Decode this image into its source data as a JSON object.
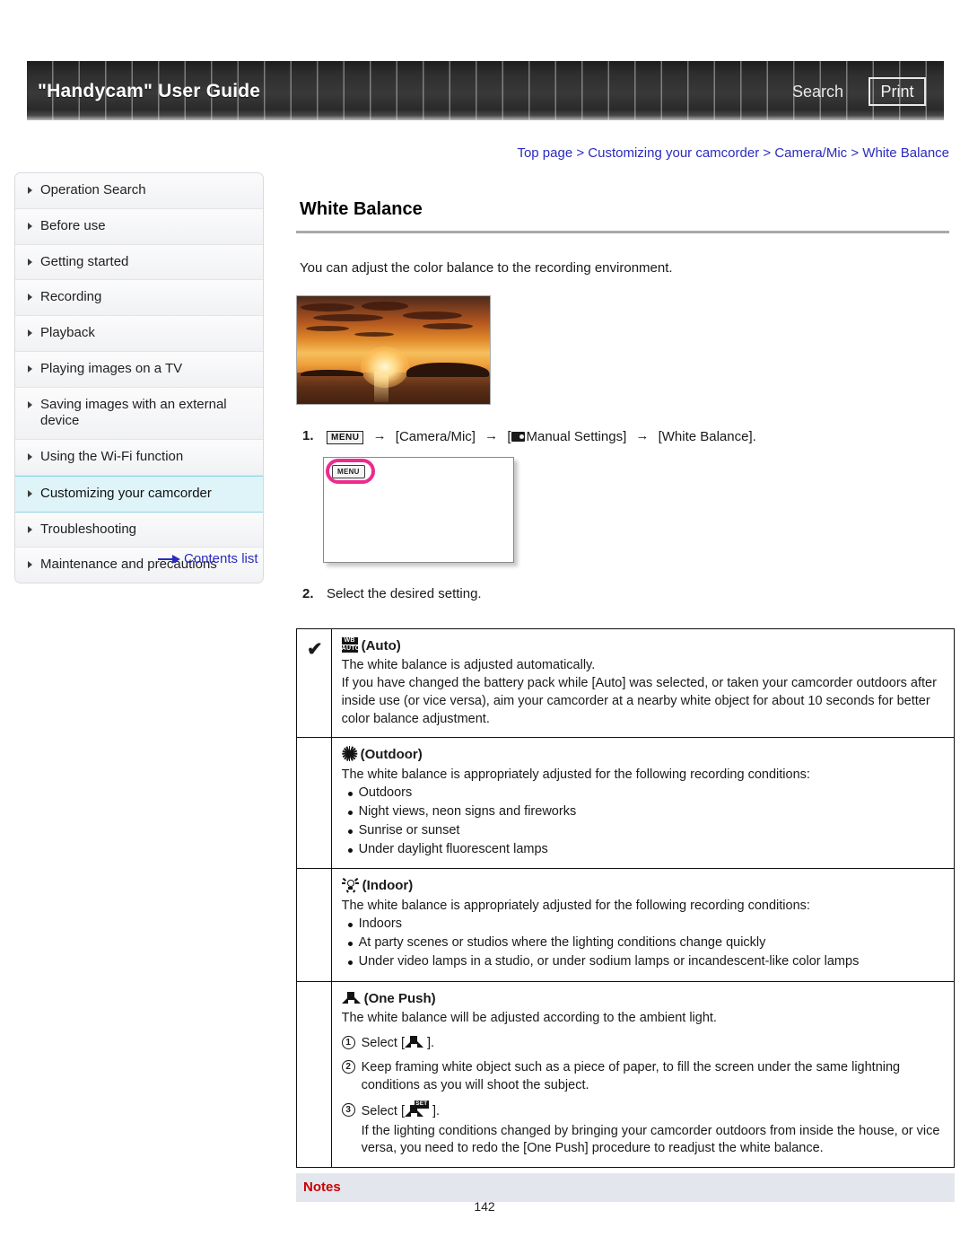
{
  "header": {
    "title": "\"Handycam\" User Guide",
    "search_label": "Search",
    "print_label": "Print"
  },
  "breadcrumb": {
    "items": [
      "Top page",
      "Customizing your camcorder",
      "Camera/Mic",
      "White Balance"
    ],
    "separator": ">"
  },
  "sidebar": {
    "items": [
      {
        "label": "Operation Search",
        "active": false
      },
      {
        "label": "Before use",
        "active": false
      },
      {
        "label": "Getting started",
        "active": false
      },
      {
        "label": "Recording",
        "active": false
      },
      {
        "label": "Playback",
        "active": false
      },
      {
        "label": "Playing images on a TV",
        "active": false
      },
      {
        "label": "Saving images with an external device",
        "active": false
      },
      {
        "label": "Using the Wi-Fi function",
        "active": false
      },
      {
        "label": "Customizing your camcorder",
        "active": true
      },
      {
        "label": "Troubleshooting",
        "active": false
      },
      {
        "label": "Maintenance and precautions",
        "active": false
      }
    ],
    "contents_link": "Contents list"
  },
  "main": {
    "page_title": "White Balance",
    "intro": "You can adjust the color balance to the recording environment.",
    "photo_caption": "sunset over water sample photo",
    "step1": {
      "number": "1.",
      "menu_chip": "MENU",
      "part_camera_mic": "[Camera/Mic]",
      "part_manual_open": "[",
      "part_manual_settings": "Manual Settings]",
      "part_white_balance": "[White Balance].",
      "arrow": "→"
    },
    "lcd_mock": {
      "menu_button_label": "MENU",
      "highlight_color": "#ee2a8e"
    },
    "step2": {
      "number": "2.",
      "text": "Select the desired setting."
    }
  },
  "options_table": {
    "rows": [
      {
        "checked": true,
        "check_glyph": "✔",
        "icon": "wb-auto-icon",
        "heading": "(Auto)",
        "lines": [
          "The white balance is adjusted automatically.",
          "If you have changed the battery pack while [Auto] was selected, or taken your camcorder outdoors after inside use (or vice versa), aim your camcorder at a nearby white object for about 10 seconds for better color balance adjustment."
        ],
        "bullets": [],
        "numbered": []
      },
      {
        "checked": false,
        "check_glyph": "",
        "icon": "outdoor-sun-icon",
        "heading": "(Outdoor)",
        "lines": [
          "The white balance is appropriately adjusted for the following recording conditions:"
        ],
        "bullets": [
          "Outdoors",
          "Night views, neon signs and fireworks",
          "Sunrise or sunset",
          "Under daylight fluorescent lamps"
        ],
        "numbered": []
      },
      {
        "checked": false,
        "check_glyph": "",
        "icon": "indoor-bulb-icon",
        "heading": "(Indoor)",
        "lines": [
          "The white balance is appropriately adjusted for the following recording conditions:"
        ],
        "bullets": [
          "Indoors",
          "At party scenes or studios where the lighting conditions change quickly",
          "Under video lamps in a studio, or under sodium lamps or incandescent-like color lamps"
        ],
        "numbered": []
      },
      {
        "checked": false,
        "check_glyph": "",
        "icon": "one-push-icon",
        "heading": "(One Push)",
        "lines": [
          "The white balance will be adjusted according to the ambient light."
        ],
        "bullets": [],
        "numbered": [
          {
            "n": "1",
            "pre": "Select [",
            "post": "].",
            "sub": ""
          },
          {
            "n": "2",
            "pre": "Keep framing white object such as a piece of paper, to fill the screen under the same lightning conditions as you will shoot the subject.",
            "post": "",
            "sub": ""
          },
          {
            "n": "3",
            "pre": "Select [",
            "post": "].",
            "sub": "If the lighting conditions changed by bringing your camcorder outdoors from inside the house, or vice versa, you need to redo the [One Push] procedure to readjust the white balance."
          }
        ]
      }
    ]
  },
  "notes": {
    "label": "Notes"
  },
  "footer": {
    "page_number": "142"
  },
  "colors": {
    "link": "#2b2bbf",
    "notes_red": "#cc0000",
    "notes_bar_bg": "#e3e7ed",
    "active_nav_bg": "#dff4f9",
    "highlight_pink": "#ee2a8e"
  }
}
